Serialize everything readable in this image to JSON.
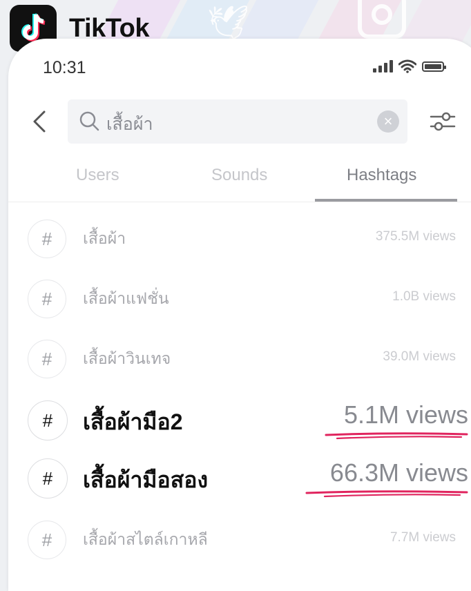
{
  "brand": {
    "name": "TikTok"
  },
  "status": {
    "time": "10:31"
  },
  "search": {
    "query": "เสื้อผ้า"
  },
  "tabs": [
    {
      "label": "Users",
      "active": false
    },
    {
      "label": "Sounds",
      "active": false
    },
    {
      "label": "Hashtags",
      "active": true
    }
  ],
  "hashtags": [
    {
      "symbol": "#",
      "name": "เสื้อผ้า",
      "views": "375.5M views",
      "highlighted": false
    },
    {
      "symbol": "#",
      "name": "เสื้อผ้าแฟชั่น",
      "views": "1.0B views",
      "highlighted": false
    },
    {
      "symbol": "#",
      "name": "เสื้อผ้าวินเทจ",
      "views": "39.0M views",
      "highlighted": false
    },
    {
      "symbol": "#",
      "name": "เสื้อผ้ามือ2",
      "views": "5.1M views",
      "highlighted": true
    },
    {
      "symbol": "#",
      "name": "เสื้อผ้ามือสอง",
      "views": "66.3M views",
      "highlighted": true
    },
    {
      "symbol": "#",
      "name": "เสื้อผ้าสไตล์เกาหลี",
      "views": "7.7M views",
      "highlighted": false
    }
  ],
  "colors": {
    "accent_underline": "#e0245e",
    "tiktok_cyan": "#25f4ee",
    "tiktok_red": "#fe2c55"
  },
  "icons": [
    "tiktok-logo-icon",
    "twitter-bird-icon",
    "instagram-icon",
    "signal-icon",
    "wifi-icon",
    "battery-icon",
    "back-chevron-icon",
    "search-icon",
    "clear-icon",
    "filter-icon",
    "hashtag-icon"
  ]
}
